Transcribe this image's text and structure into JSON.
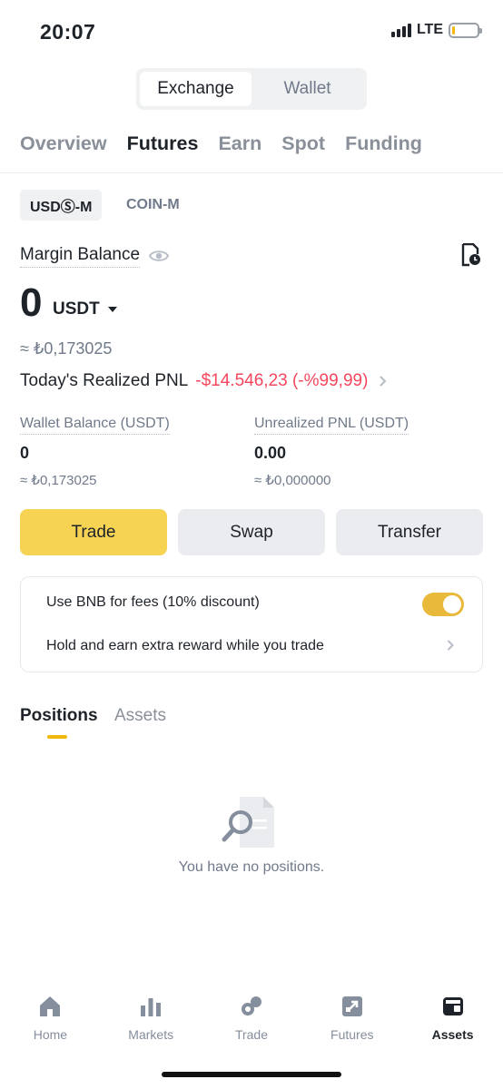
{
  "status_bar": {
    "time": "20:07",
    "network": "LTE"
  },
  "segmented": {
    "options": [
      "Exchange",
      "Wallet"
    ],
    "selected": "Exchange"
  },
  "tabs": [
    "Overview",
    "Futures",
    "Earn",
    "Spot",
    "Funding"
  ],
  "active_tab": "Futures",
  "sub_tabs": [
    "USDⓈ-M",
    "COIN-M"
  ],
  "margin_balance": {
    "label": "Margin Balance",
    "value": "0",
    "unit": "USDT",
    "approx": "≈ ₺0,173025"
  },
  "pnl": {
    "label": "Today's Realized PNL",
    "value": "-$14.546,23 (-%99,99)"
  },
  "wallet_balance": {
    "label": "Wallet Balance (USDT)",
    "value": "0",
    "approx": "≈ ₺0,173025"
  },
  "unrealized_pnl": {
    "label": "Unrealized PNL (USDT)",
    "value": "0.00",
    "approx": "≈ ₺0,000000"
  },
  "actions": {
    "trade": "Trade",
    "swap": "Swap",
    "transfer": "Transfer"
  },
  "bnb": {
    "fees_label": "Use BNB for fees (10% discount)",
    "fees_enabled": true,
    "earn_label": "Hold and earn extra reward while you trade"
  },
  "position_tabs": [
    "Positions",
    "Assets"
  ],
  "empty_state": "You have no positions.",
  "bottom_nav": [
    {
      "label": "Home",
      "icon": "home-icon"
    },
    {
      "label": "Markets",
      "icon": "markets-icon"
    },
    {
      "label": "Trade",
      "icon": "trade-icon"
    },
    {
      "label": "Futures",
      "icon": "futures-icon"
    },
    {
      "label": "Assets",
      "icon": "assets-icon",
      "active": true
    }
  ],
  "colors": {
    "accent": "#F0B90B",
    "negative": "#F6465D",
    "text": "#1E2329",
    "muted": "#707A8A"
  }
}
